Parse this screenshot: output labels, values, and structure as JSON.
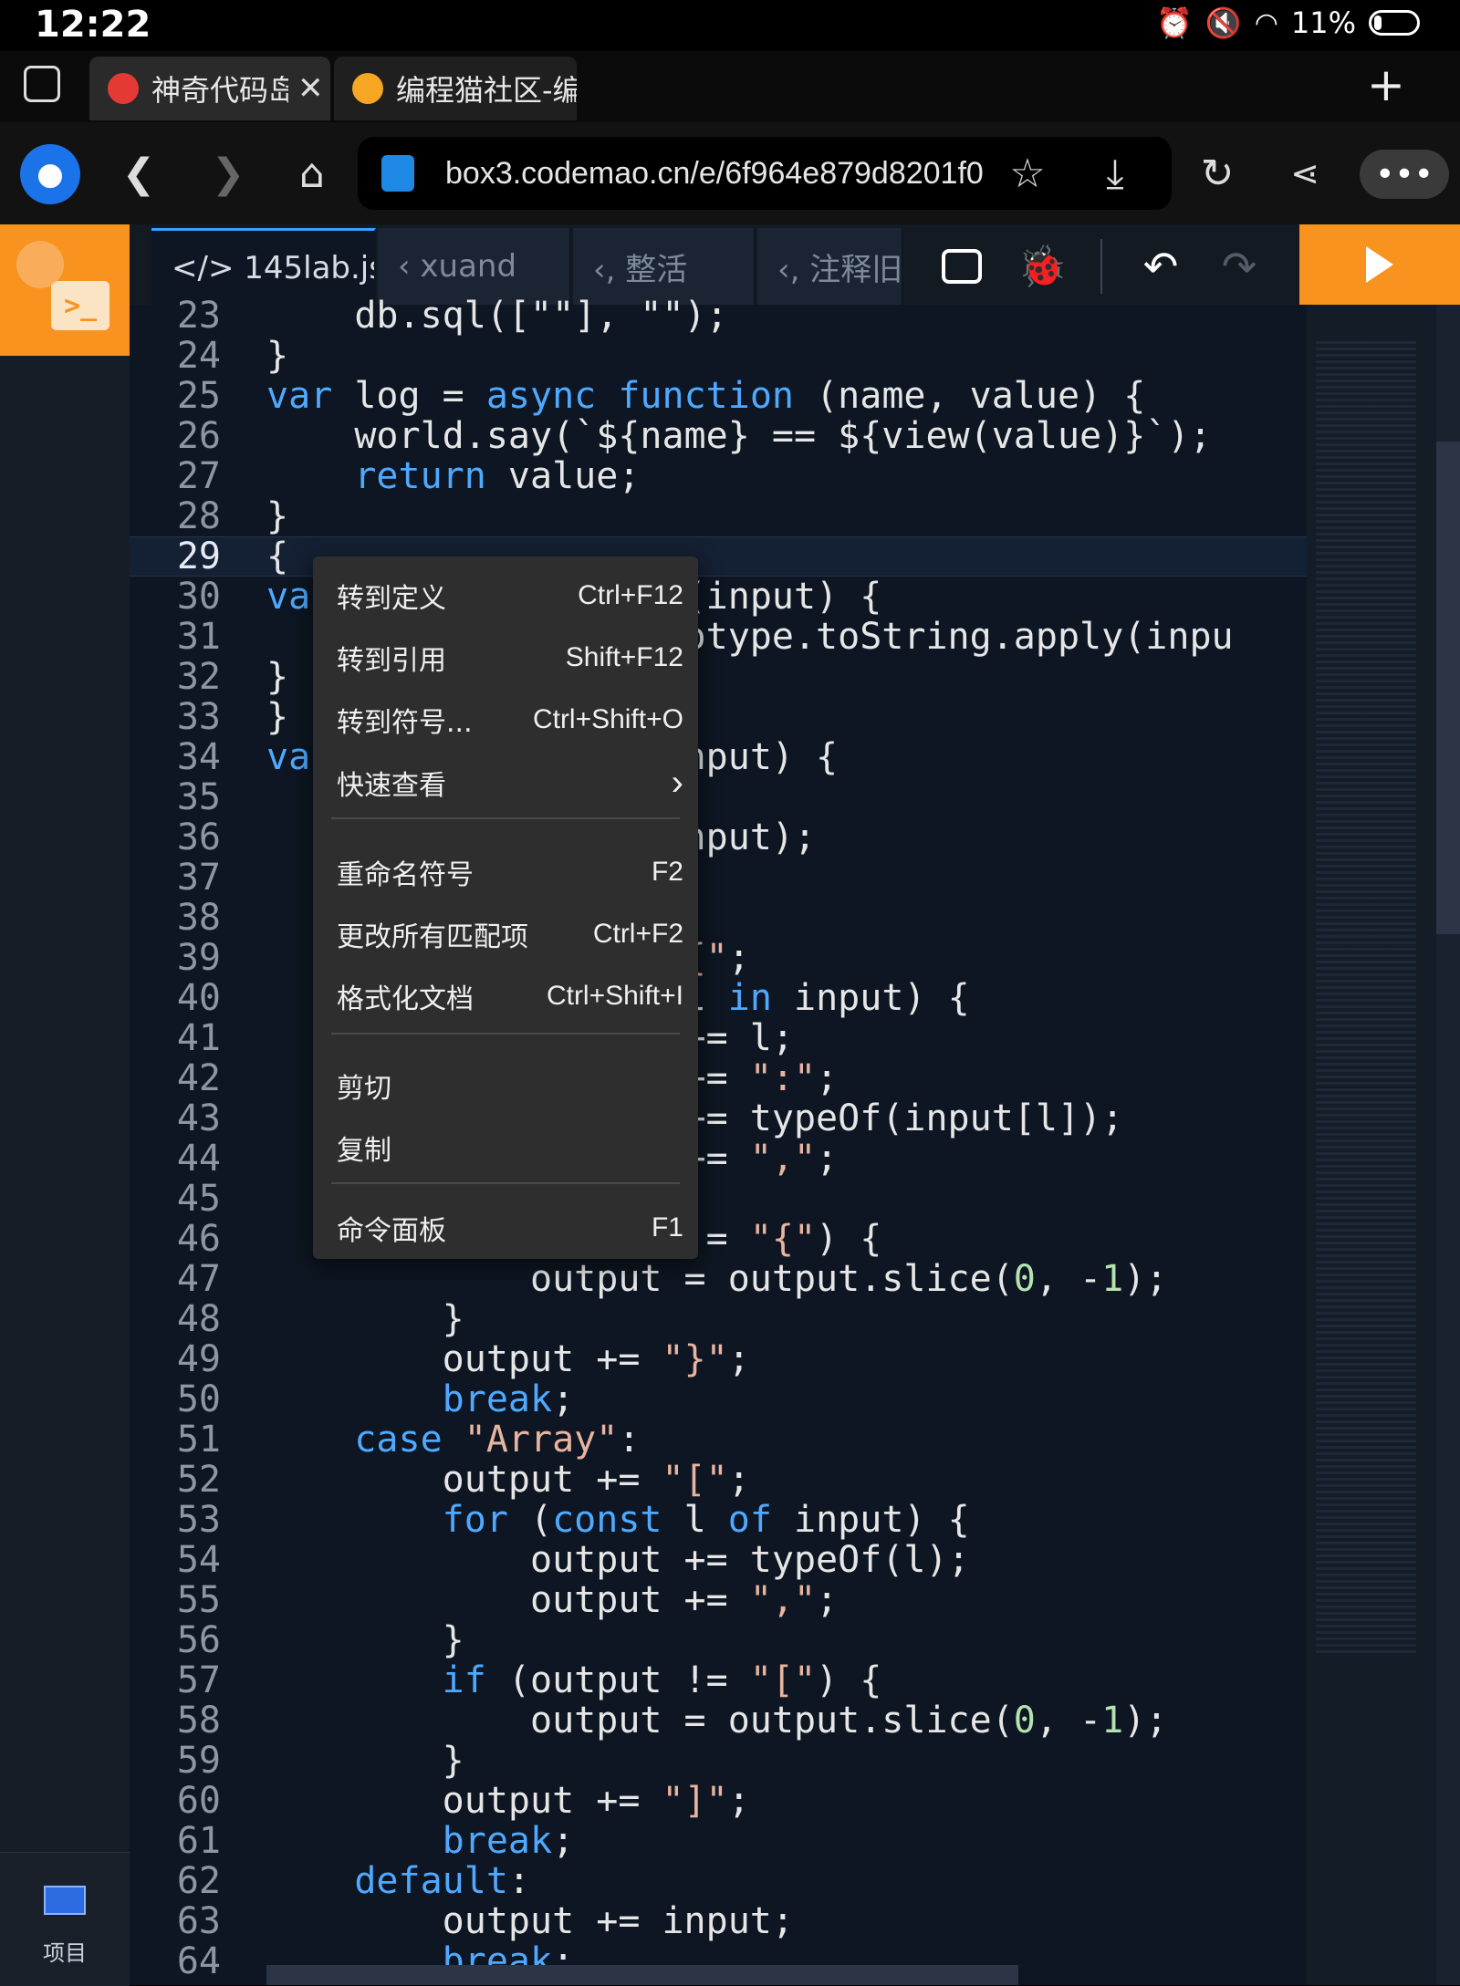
{
  "status": {
    "time": "12:22",
    "battery": "11%"
  },
  "browser_tabs": [
    {
      "label": "神奇代码岛",
      "active": true
    },
    {
      "label": "编程猫社区-编",
      "active": false
    }
  ],
  "address": {
    "url": "box3.codemao.cn/e/6f964e879d8201f0"
  },
  "ide_tabs": [
    {
      "label": "</> 145lab.js"
    },
    {
      "label": "‹ xuand"
    },
    {
      "label": "‹, 整活"
    },
    {
      "label": "‹, 注释旧"
    }
  ],
  "sidebar": {
    "project_label": "项目"
  },
  "context_menu": [
    {
      "label": "转到定义",
      "shortcut": "Ctrl+F12"
    },
    {
      "label": "转到引用",
      "shortcut": "Shift+F12"
    },
    {
      "label": "转到符号...",
      "shortcut": "Ctrl+Shift+O"
    },
    {
      "label": "快速查看",
      "shortcut": "›"
    },
    {
      "label": "重命名符号",
      "shortcut": "F2"
    },
    {
      "label": "更改所有匹配项",
      "shortcut": "Ctrl+F2"
    },
    {
      "label": "格式化文档",
      "shortcut": "Ctrl+Shift+I"
    },
    {
      "label": "剪切",
      "shortcut": ""
    },
    {
      "label": "复制",
      "shortcut": ""
    },
    {
      "label": "命令面板",
      "shortcut": "F1"
    }
  ],
  "code_lines": [
    "23",
    "24",
    "25",
    "26",
    "27",
    "28",
    "29",
    "30",
    "31",
    "32",
    "33",
    "34",
    "35",
    "36",
    "37",
    "38",
    "39",
    "40",
    "41",
    "42",
    "43",
    "44",
    "45",
    "46",
    "47",
    "48",
    "49",
    "50",
    "51",
    "52",
    "53",
    "54",
    "55",
    "56",
    "57",
    "58",
    "59",
    "60",
    "61",
    "62",
    "63",
    "64"
  ],
  "colors": {
    "accent_orange": "#f7931e",
    "keyword_blue": "#4fa9ff",
    "editor_bg": "#0d1622"
  }
}
